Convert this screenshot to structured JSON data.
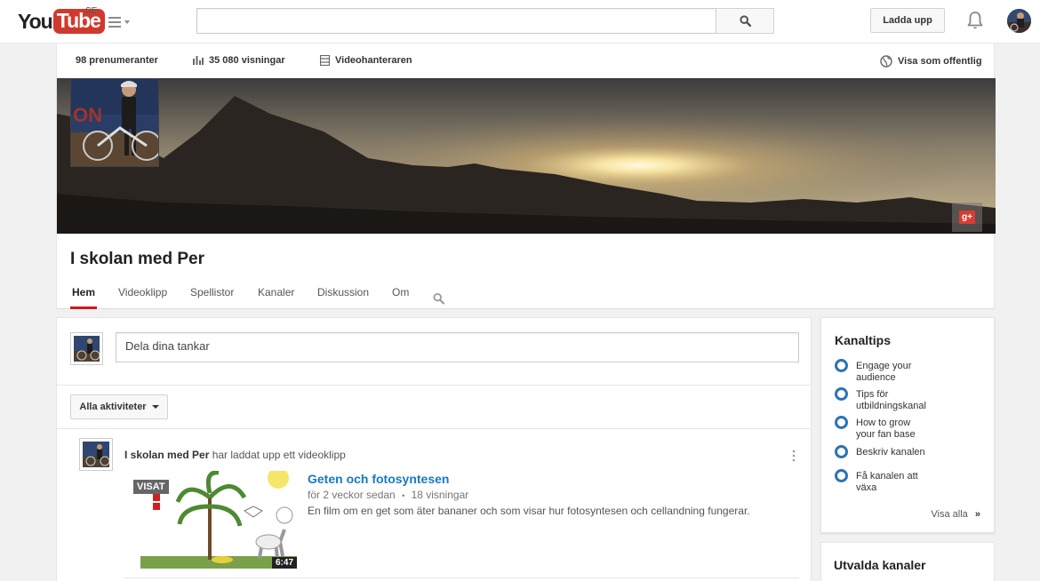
{
  "masthead": {
    "logo_you": "You",
    "logo_tube": "Tube",
    "region": "SE",
    "search_placeholder": "",
    "upload_label": "Ladda upp"
  },
  "stats": {
    "subscribers": "98 prenumeranter",
    "views": "35 080 visningar",
    "video_manager": "Videohanteraren",
    "view_as_public": "Visa som offentlig"
  },
  "channel": {
    "title": "I skolan med Per",
    "tabs": [
      "Hem",
      "Videoklipp",
      "Spellistor",
      "Kanaler",
      "Diskussion",
      "Om"
    ]
  },
  "feed": {
    "share_placeholder": "Dela dina tankar",
    "filter_label": "Alla aktiviteter",
    "activity": {
      "author": "I skolan med Per",
      "action": " har laddat upp ett videoklipp",
      "watched_badge": "VISAT",
      "duration": "6:47",
      "video_title": "Geten och fotosyntesen",
      "age": "för 2 veckor sedan",
      "views": "18 visningar",
      "description": "En film om en get som äter bananer och som visar hur fotosyntesen och cellandning fungerar."
    }
  },
  "sidebar": {
    "tips_title": "Kanaltips",
    "tips": [
      "Engage your audience",
      "Tips för utbildningskanal",
      "How to grow your fan base",
      "Beskriv kanalen",
      "Få kanalen att växa"
    ],
    "see_all": "Visa alla",
    "featured_title": "Utvalda kanaler"
  },
  "colors": {
    "brand_red": "#cc181e",
    "link_blue": "#167ac6",
    "tip_ring": "#2b73b7"
  },
  "icons": [
    "guide-menu-icon",
    "search-icon",
    "bell-icon",
    "bar-chart-icon",
    "film-icon",
    "globe-icon",
    "google-plus-icon",
    "more-vert-icon"
  ]
}
